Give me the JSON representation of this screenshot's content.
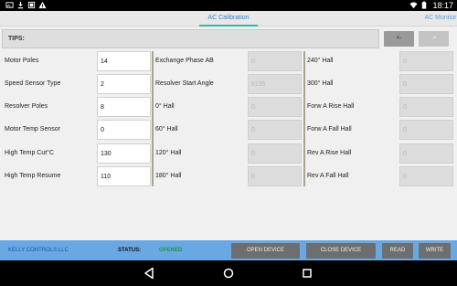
{
  "statusbar": {
    "time": "18:17"
  },
  "tabs": {
    "active": "AC Calibration",
    "other": "AC Monitor"
  },
  "tips": {
    "label": "TIPS:"
  },
  "nav": {
    "prev_label": "<-",
    "next_label": "->"
  },
  "col1": [
    {
      "label": "Motor Poles",
      "value": "14"
    },
    {
      "label": "Speed Sensor Type",
      "value": "2"
    },
    {
      "label": "Resolver Poles",
      "value": "8"
    },
    {
      "label": "Motor Temp Sensor",
      "value": "0"
    },
    {
      "label": "High Temp Cut°C",
      "value": "130"
    },
    {
      "label": "High Temp Resume",
      "value": "110"
    }
  ],
  "col2": [
    {
      "label": "Exchange Phase AB",
      "value": "0"
    },
    {
      "label": "Resolver Start Angle",
      "value": "8135"
    },
    {
      "label": "0°   Hall",
      "value": "0"
    },
    {
      "label": "60°  Hall",
      "value": "0"
    },
    {
      "label": "120° Hall",
      "value": "0"
    },
    {
      "label": "180° Hall",
      "value": "0"
    }
  ],
  "col3": [
    {
      "label": "240° Hall",
      "value": "0"
    },
    {
      "label": "300° Hall",
      "value": "0"
    },
    {
      "label": "Forw A Rise Hall",
      "value": "0"
    },
    {
      "label": "Forw A Fall Hall",
      "value": "0"
    },
    {
      "label": "Rev  A Rise Hall",
      "value": "0"
    },
    {
      "label": "Rev  A Fall Hall",
      "value": "0"
    }
  ],
  "bottom": {
    "company": "KELLY CONTROLS.LLC",
    "status_label": "STATUS:",
    "status_value": "OPENED",
    "open_label": "OPEN DEVICE",
    "close_label": "CLOSE DEVICE",
    "read_label": "READ",
    "write_label": "WRITE"
  },
  "colors": {
    "accent": "#31b6a2",
    "tab_text": "#2f86c9",
    "bottom_bar": "#6aa8e4",
    "status_ok": "#1e9a3a"
  },
  "icons": [
    "image-icon",
    "download-icon",
    "notification-icon",
    "warning-icon",
    "wifi-icon",
    "battery-icon",
    "back-icon",
    "home-icon",
    "recents-icon"
  ]
}
